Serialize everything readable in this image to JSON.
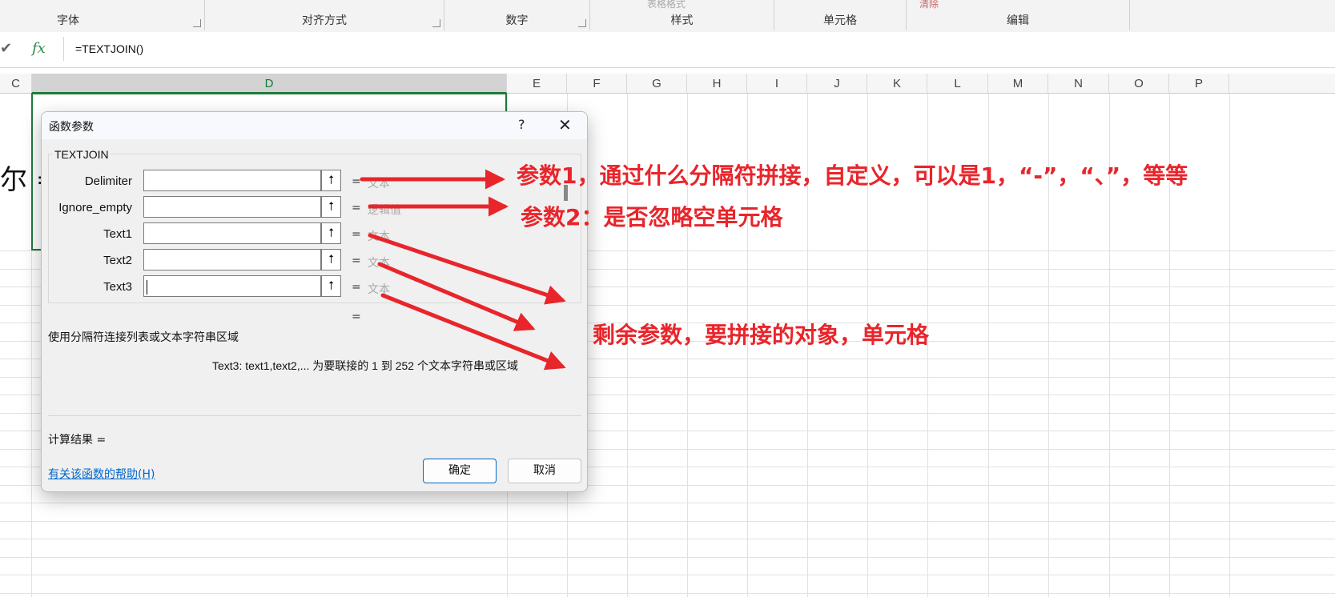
{
  "ribbon": {
    "groups": [
      "字体",
      "对齐方式",
      "数字",
      "样式",
      "单元格",
      "编辑"
    ],
    "faint_top": [
      "表格格式",
      "清除"
    ]
  },
  "formula_bar": {
    "cancel_glyph": "✔",
    "fx_glyph": "fx",
    "formula": "=TEXTJOIN()"
  },
  "grid": {
    "columns": [
      "C",
      "D",
      "E",
      "F",
      "G",
      "H",
      "I",
      "J",
      "K",
      "L",
      "M",
      "N",
      "O",
      "P"
    ],
    "selected_column": "D",
    "cell_partial_text": "尔 ="
  },
  "dialog": {
    "title": "函数参数",
    "help_glyph": "?",
    "close_glyph": "✕",
    "function_name": "TEXTJOIN",
    "params": [
      {
        "label": "Delimiter",
        "value": "",
        "hint": "文本"
      },
      {
        "label": "Ignore_empty",
        "value": "",
        "hint": "逻辑值"
      },
      {
        "label": "Text1",
        "value": "",
        "hint": "文本"
      },
      {
        "label": "Text2",
        "value": "",
        "hint": "文本"
      },
      {
        "label": "Text3",
        "value": "",
        "hint": "文本"
      }
    ],
    "equals": "=",
    "ref_button_glyph": "⭡",
    "description": "使用分隔符连接列表或文本字符串区域",
    "arg_description": "Text3:   text1,text2,... 为要联接的 1 到 252 个文本字符串或区域",
    "result_label": "计算结果 =",
    "help_link": "有关该函数的帮助(H)",
    "ok_label": "确定",
    "cancel_label": "取消"
  },
  "annotations": {
    "a1": "参数1，通过什么分隔符拼接，自定义，可以是1，“-”，“、”，等等",
    "a2": "参数2：是否忽略空单元格",
    "a3": "剩余参数，要拼接的对象，单元格",
    "arrow_color": "#e8252b"
  }
}
